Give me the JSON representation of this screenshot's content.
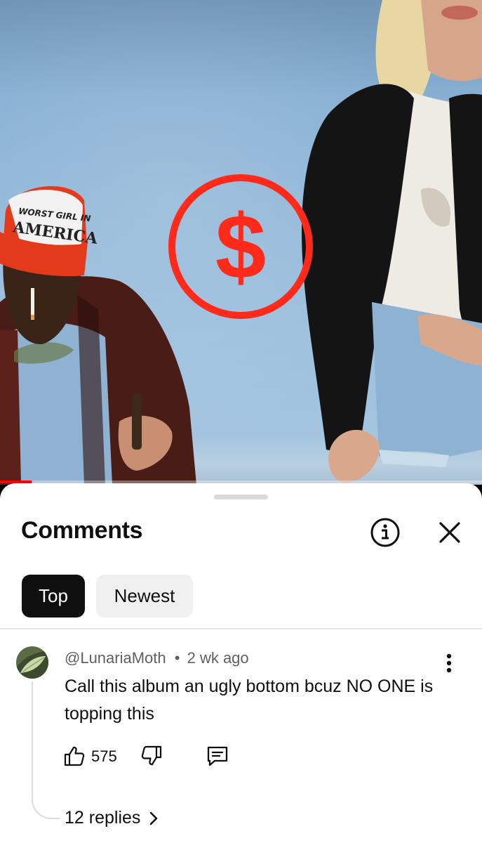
{
  "video": {
    "progress_fraction": 0.065,
    "hat_text_line1": "WORST GIRL IN",
    "hat_text_line2": "AMERICA",
    "dollar_sign": "$",
    "accent_color": "#ff2a1a"
  },
  "comments_panel": {
    "title": "Comments",
    "info_icon": "info-circle-icon",
    "close_icon": "close-icon",
    "sort_tabs": [
      {
        "label": "Top",
        "selected": true
      },
      {
        "label": "Newest",
        "selected": false
      }
    ]
  },
  "comment": {
    "author": "@LunariaMoth",
    "separator": "•",
    "time_ago": "2 wk ago",
    "text": "Call this album an ugly bottom bcuz NO ONE is topping this",
    "like_count": "575",
    "replies_label": "12 replies",
    "icons": {
      "like": "thumbs-up-icon",
      "dislike": "thumbs-down-icon",
      "reply": "comment-reply-icon",
      "more": "more-vertical-icon",
      "chevron": "chevron-right-icon"
    }
  }
}
